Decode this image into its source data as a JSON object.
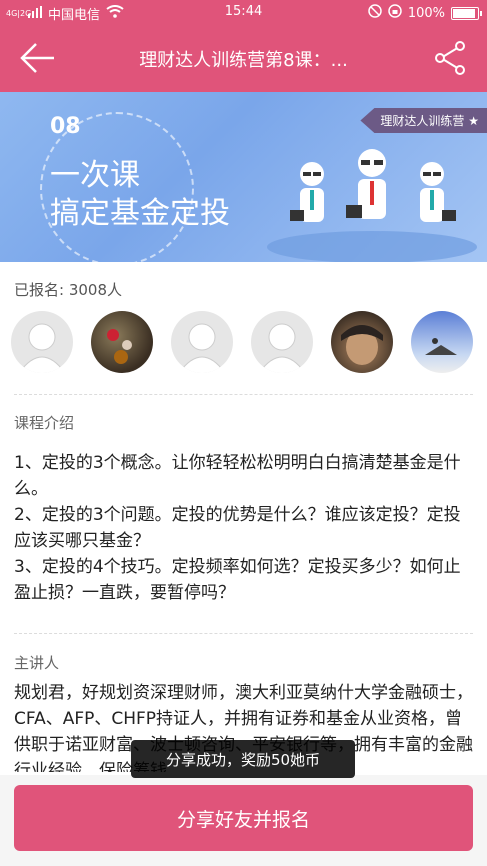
{
  "status_bar": {
    "network": "4G|2G",
    "carrier": "中国电信",
    "time": "15:44",
    "battery": "100%",
    "battery_level": 1.0
  },
  "nav": {
    "title": "理财达人训练营第8课：...",
    "back_icon": "back-arrow-icon",
    "share_icon": "share-icon"
  },
  "banner": {
    "number": "08",
    "line1": "一次课",
    "line2": "搞定基金定投",
    "ribbon": "理财达人训练营 ★"
  },
  "enrollment": {
    "text": "已报名: 3008人"
  },
  "intro": {
    "title": "课程介绍",
    "body": "1、定投的3个概念。让你轻轻松松明明白白搞清楚基金是什么。\n2、定投的3个问题。定投的优势是什么？谁应该定投？定投应该买哪只基金？\n3、定投的4个技巧。定投频率如何选？定投买多少？如何止盈止损？一直跌，要暂停吗？"
  },
  "speaker": {
    "title": "主讲人",
    "body": "规划君，好规划资深理财师，澳大利亚莫纳什大学金融硕士，CFA、AFP、CHFP持证人，并拥有证券和基金从业资格，曾供职于诺亚财富、波士顿咨询、平安银行等，拥有丰富的金融行业经验，保险筹钱"
  },
  "toast": {
    "text": "分享成功，奖励50她币"
  },
  "cta": {
    "label": "分享好友并报名"
  },
  "colors": {
    "brand": "#e0547a"
  }
}
